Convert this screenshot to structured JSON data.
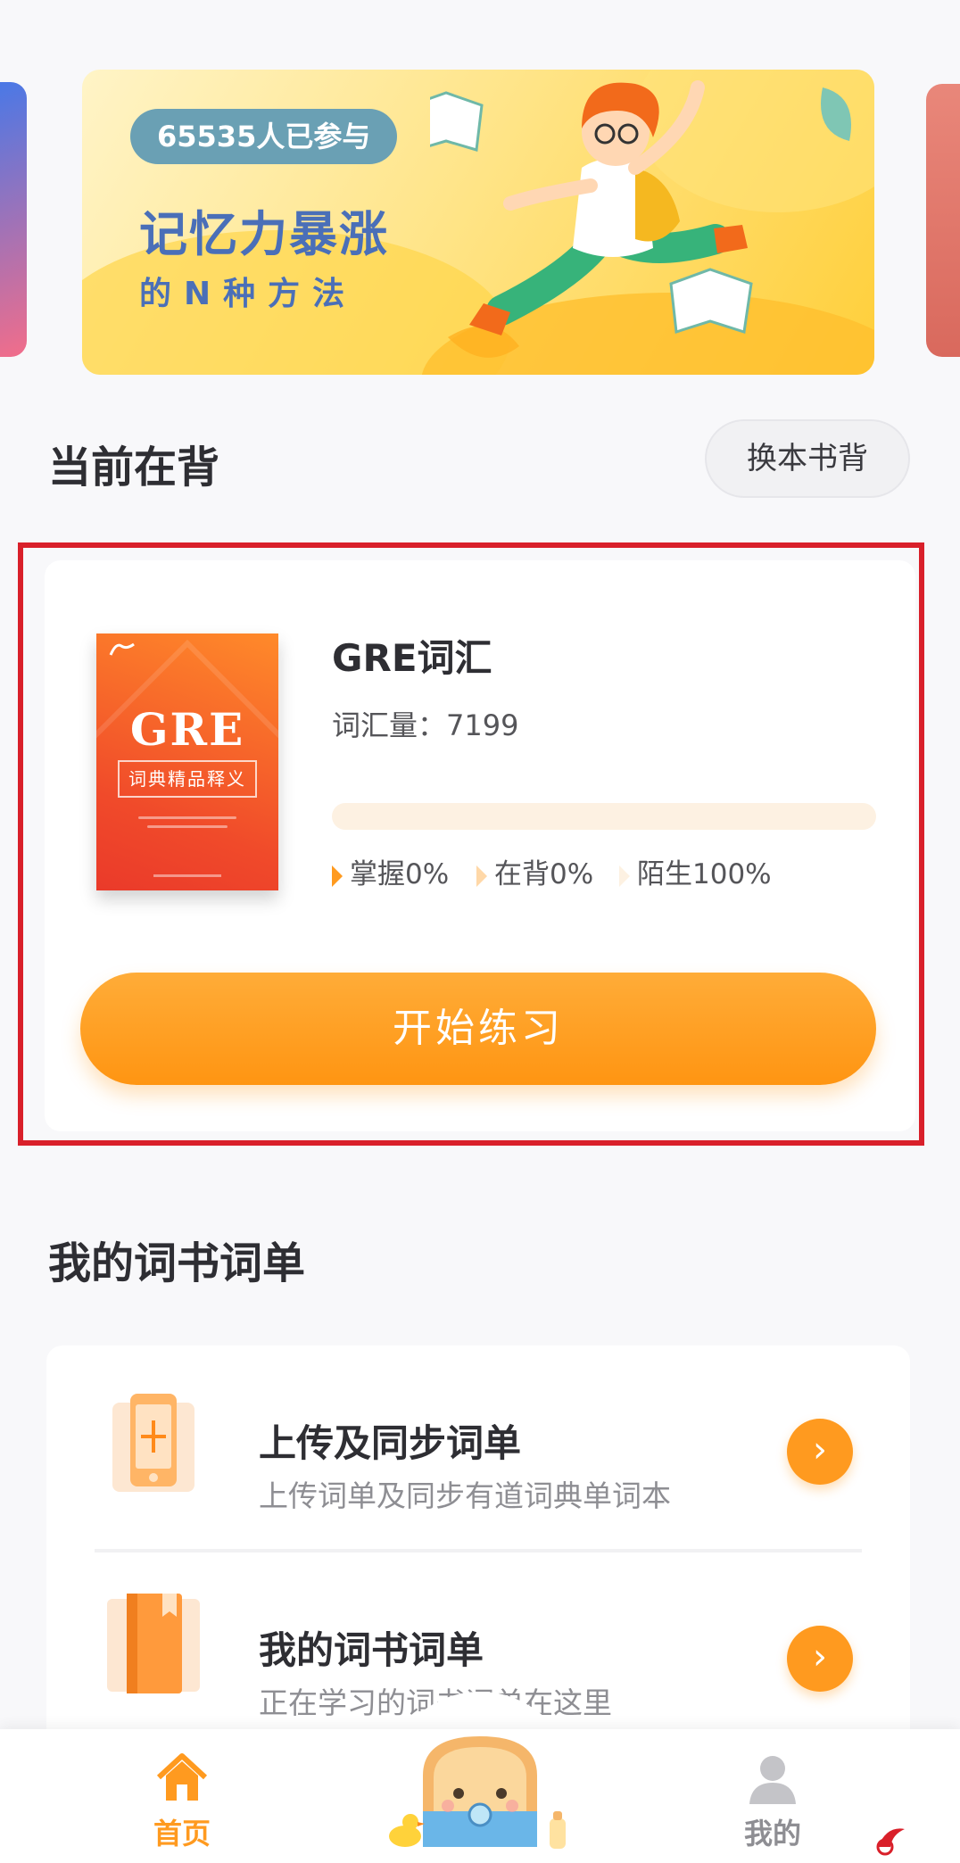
{
  "banner": {
    "participants": "65535人已参与",
    "title": "记忆力暴涨",
    "subtitle": "的N种方法"
  },
  "current": {
    "section_title": "当前在背",
    "switch_label": "换本书背",
    "book": {
      "cover_title": "GRE",
      "cover_subtitle": "词典精品释义",
      "title": "GRE词汇",
      "count_label": "词汇量：7199",
      "mastered_fraction": 0,
      "legend": {
        "mastered": "掌握0%",
        "learning": "在背0%",
        "new": "陌生100%"
      }
    },
    "start_label": "开始练习"
  },
  "wordlists": {
    "section_title": "我的词书词单",
    "items": [
      {
        "title": "上传及同步词单",
        "subtitle": "上传词单及同步有道词典单词本"
      },
      {
        "title": "我的词书词单",
        "subtitle": "正在学习的词书词单在这里"
      }
    ]
  },
  "nav": {
    "home": "首页",
    "mine": "我的"
  },
  "colors": {
    "accent": "#ff9a1f",
    "highlight": "#d9202a",
    "banner_text": "#4a6fb8"
  }
}
